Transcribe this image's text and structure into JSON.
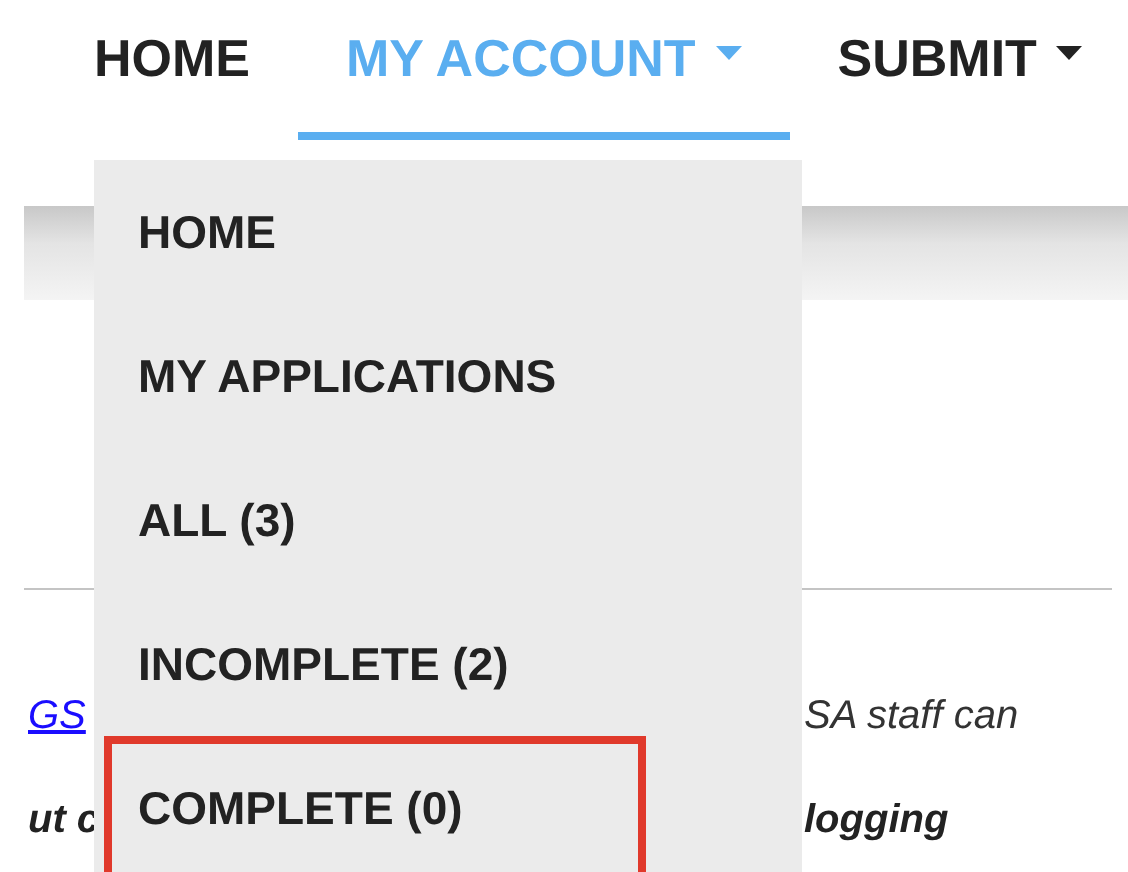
{
  "nav": {
    "tabs": [
      {
        "label": "HOME",
        "selected": false,
        "has_caret": false
      },
      {
        "label": "MY ACCOUNT",
        "selected": true,
        "has_caret": true
      },
      {
        "label": "SUBMIT",
        "selected": false,
        "has_caret": true
      }
    ]
  },
  "dropdown": {
    "items": [
      {
        "label": "HOME",
        "highlighted": false
      },
      {
        "label": "MY APPLICATIONS",
        "highlighted": false
      },
      {
        "label": "ALL (3)",
        "highlighted": false
      },
      {
        "label": "INCOMPLETE (2)",
        "highlighted": false
      },
      {
        "label": "COMPLETE (0)",
        "highlighted": true
      }
    ]
  },
  "content": {
    "lines": [
      {
        "left": {
          "kind": "link",
          "text": "GS"
        },
        "right": "SA staff can",
        "bold": false
      },
      {
        "left": {
          "kind": "text",
          "text": "ut c"
        },
        "right": "logging",
        "bold": true
      }
    ]
  }
}
